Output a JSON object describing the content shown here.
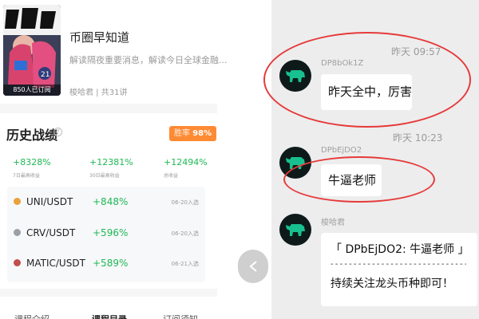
{
  "course": {
    "cover_caption": "850人已订阅",
    "title": "币圈早知道",
    "description": "解读隔夜重要消息，解读今日全球金融...",
    "meta": "梭哈君 | 共31讲"
  },
  "history": {
    "title": "历史战绩",
    "info_icon": "info-icon",
    "winrate_label": "胜率",
    "winrate_value": "98%",
    "stats": [
      {
        "value": "+8328%",
        "label": "7日最高收益"
      },
      {
        "value": "+12381%",
        "label": "30日最高收益"
      },
      {
        "value": "+12494%",
        "label": "总收益"
      }
    ],
    "pairs": [
      {
        "name": "UNI/USDT",
        "gain": "+848%",
        "date": "06-20入选",
        "dot_color": "#e8a33b"
      },
      {
        "name": "CRV/USDT",
        "gain": "+596%",
        "date": "06-20入选",
        "dot_color": "#9aa0a6"
      },
      {
        "name": "MATIC/USDT",
        "gain": "+589%",
        "date": "06-21入选",
        "dot_color": "#c0504d"
      }
    ]
  },
  "tabs": [
    "课程介绍",
    "课程目录",
    "订阅须知"
  ],
  "chat": {
    "time1": "昨天 09:57",
    "msg1": {
      "sender": "DP8bOk1Z",
      "text": "昨天全中，厉害"
    },
    "time2": "昨天 10:23",
    "msg2": {
      "sender": "DPbEjDO2",
      "text": "牛逼老师"
    },
    "msg3": {
      "sender": "梭哈君",
      "line1": "「 DPbEjDO2: 牛逼老师 」",
      "separator": "- - - - - - - - - - - - - - - - - - - - - - - - - - - - - - - -",
      "line3": "持续关注龙头币种即可！"
    }
  },
  "colors": {
    "gain": "#1db954",
    "badge": "#ff8a34",
    "highlight": "#e63a3a",
    "avatar_bull": "#18c08f"
  }
}
